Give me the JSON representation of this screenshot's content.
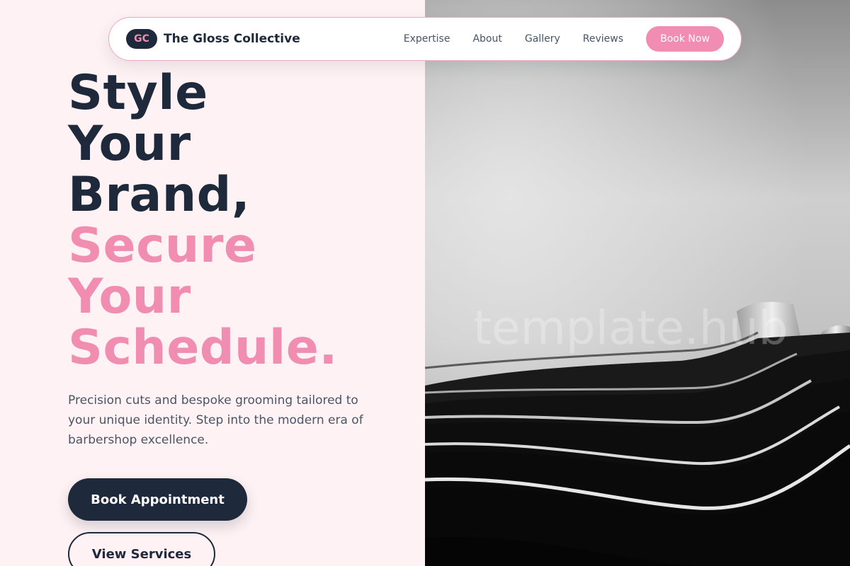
{
  "nav": {
    "brand_badge": "GC",
    "brand_name": "The Gloss Collective",
    "links": [
      "Expertise",
      "About",
      "Gallery",
      "Reviews"
    ],
    "cta_label": "Book Now"
  },
  "hero": {
    "headline_dark": [
      "Style",
      "Your",
      "Brand,"
    ],
    "headline_pink": [
      "Secure",
      "Your",
      "Schedule."
    ],
    "subtext": "Precision cuts and bespoke grooming tailored to your unique identity. Step into the modern era of barbershop excellence.",
    "primary_button": "Book Appointment",
    "secondary_button": "View Services"
  },
  "image": {
    "watermark": "template.hub"
  },
  "colors": {
    "navy": "#1e293b",
    "accent_pink": "#f08db0",
    "background_blush": "#fef2f4",
    "body_text": "#4b5563"
  }
}
